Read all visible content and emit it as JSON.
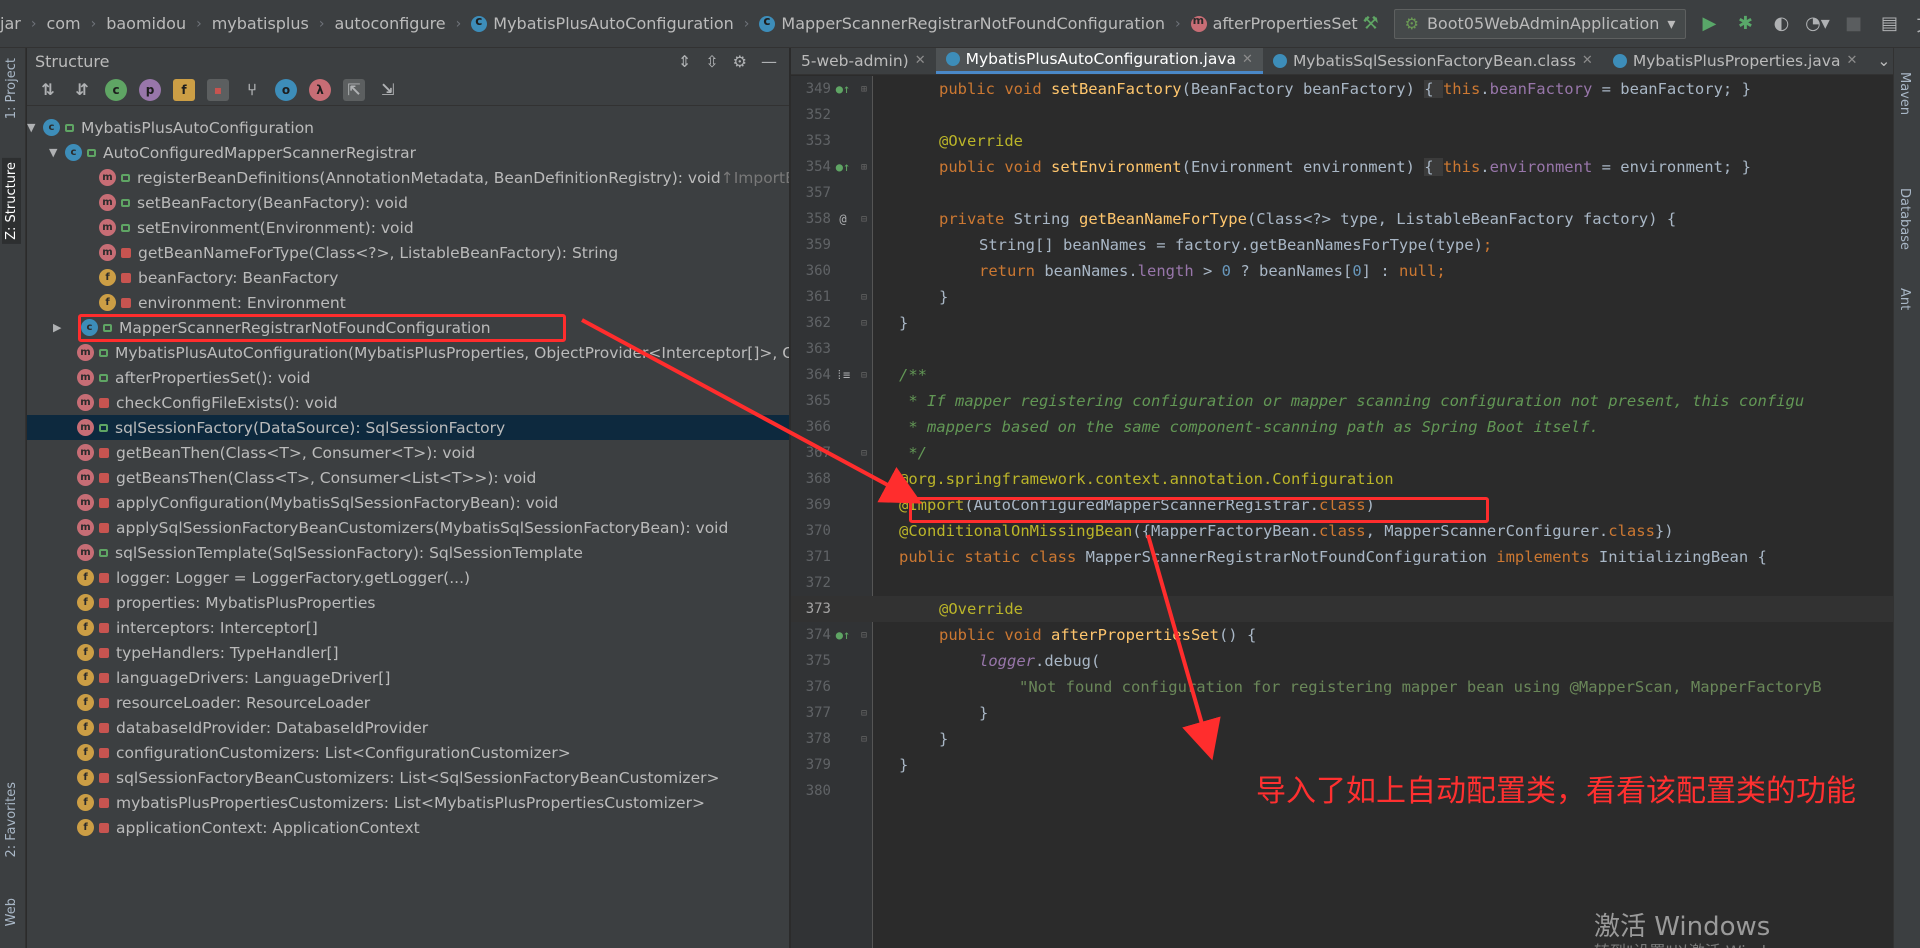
{
  "navbar": {
    "crumbs": [
      "jar",
      "com",
      "baomidou",
      "mybatisplus",
      "autoconfigure",
      "MybatisPlusAutoConfiguration",
      "MapperScannerRegistrarNotFoundConfiguration",
      "afterPropertiesSet"
    ],
    "run_config": "Boot05WebAdminApplication"
  },
  "left_strip": {
    "project_tab": "1: Project",
    "structure_tab": "Z: Structure",
    "favorites_tab": "2: Favorites",
    "web_tab": "Web"
  },
  "structure": {
    "title": "Structure",
    "items": [
      {
        "text": "MybatisPlusAutoConfiguration",
        "hint": ""
      },
      {
        "text": "AutoConfiguredMapperScannerRegistrar",
        "hint": ""
      },
      {
        "text": "registerBeanDefinitions(AnnotationMetadata, BeanDefinitionRegistry): void",
        "hint": " ↑ImportBeanD"
      },
      {
        "text": "setBeanFactory(BeanFactory): void",
        "hint": ""
      },
      {
        "text": "setEnvironment(Environment): void",
        "hint": ""
      },
      {
        "text": "getBeanNameForType(Class<?>, ListableBeanFactory): String",
        "hint": ""
      },
      {
        "text": "beanFactory: BeanFactory",
        "hint": ""
      },
      {
        "text": "environment: Environment",
        "hint": ""
      },
      {
        "text": "MapperScannerRegistrarNotFoundConfiguration",
        "hint": ""
      },
      {
        "text": "MybatisPlusAutoConfiguration(MybatisPlusProperties, ObjectProvider<Interceptor[]>, Obje",
        "hint": ""
      },
      {
        "text": "afterPropertiesSet(): void",
        "hint": ""
      },
      {
        "text": "checkConfigFileExists(): void",
        "hint": ""
      },
      {
        "text": "sqlSessionFactory(DataSource): SqlSessionFactory",
        "hint": ""
      },
      {
        "text": "getBeanThen(Class<T>, Consumer<T>): void",
        "hint": ""
      },
      {
        "text": "getBeansThen(Class<T>, Consumer<List<T>>): void",
        "hint": ""
      },
      {
        "text": "applyConfiguration(MybatisSqlSessionFactoryBean): void",
        "hint": ""
      },
      {
        "text": "applySqlSessionFactoryBeanCustomizers(MybatisSqlSessionFactoryBean): void",
        "hint": ""
      },
      {
        "text": "sqlSessionTemplate(SqlSessionFactory): SqlSessionTemplate",
        "hint": ""
      },
      {
        "text": "logger: Logger = LoggerFactory.getLogger(...)",
        "hint": ""
      },
      {
        "text": "properties: MybatisPlusProperties",
        "hint": ""
      },
      {
        "text": "interceptors: Interceptor[]",
        "hint": ""
      },
      {
        "text": "typeHandlers: TypeHandler[]",
        "hint": ""
      },
      {
        "text": "languageDrivers: LanguageDriver[]",
        "hint": ""
      },
      {
        "text": "resourceLoader: ResourceLoader",
        "hint": ""
      },
      {
        "text": "databaseIdProvider: DatabaseIdProvider",
        "hint": ""
      },
      {
        "text": "configurationCustomizers: List<ConfigurationCustomizer>",
        "hint": ""
      },
      {
        "text": "sqlSessionFactoryBeanCustomizers: List<SqlSessionFactoryBeanCustomizer>",
        "hint": ""
      },
      {
        "text": "mybatisPlusPropertiesCustomizers: List<MybatisPlusPropertiesCustomizer>",
        "hint": ""
      },
      {
        "text": "applicationContext: ApplicationContext",
        "hint": ""
      }
    ]
  },
  "tabs": [
    {
      "label": "5-web-admin)",
      "active": false
    },
    {
      "label": "MybatisPlusAutoConfiguration.java",
      "active": true
    },
    {
      "label": "MybatisSqlSessionFactoryBean.class",
      "active": false
    },
    {
      "label": "MybatisPlusProperties.java",
      "active": false
    }
  ],
  "code": {
    "line_numbers": [
      "349",
      "352",
      "353",
      "354",
      "357",
      "358",
      "359",
      "360",
      "361",
      "362",
      "363",
      "364",
      "365",
      "366",
      "367",
      "368",
      "369",
      "370",
      "371",
      "372",
      "373",
      "374",
      "375",
      "376",
      "377",
      "378",
      "379",
      "380"
    ],
    "l349a": "public void ",
    "l349b": "setBeanFactory",
    "l349c": "(BeanFactory beanFactory) ",
    "l349d": "{ ",
    "l349e": "this",
    "l349f": ".",
    "l349g": "beanFactory",
    "l349h": " = beanFactory; }",
    "l353": "@Override",
    "l354a": "public void ",
    "l354b": "setEnvironment",
    "l354c": "(Environment environment) ",
    "l354d": "{ ",
    "l354e": "this",
    "l354f": ".",
    "l354g": "environment",
    "l354h": " = environment; }",
    "l358a": "private ",
    "l358b": "String ",
    "l358c": "getBeanNameForType",
    "l358d": "(Class<?> type, ListableBeanFactory factory) {",
    "l359a": "String[] beanNames = factory.getBeanNamesForType(type)",
    "l359b": ";",
    "l360a": "return ",
    "l360b": "beanNames.",
    "l360c": "length",
    "l360d": " > ",
    "l360e": "0",
    "l360f": " ? beanNames[",
    "l360g": "0",
    "l360h": "] : ",
    "l360i": "null",
    "l360j": ";",
    "l361": "}",
    "l362": "}",
    "l364": "/**",
    "l365": " * If mapper registering configuration or mapper scanning configuration not present, this configu",
    "l366": " * mappers based on the same component-scanning path as Spring Boot itself.",
    "l367": " */",
    "l368a": "@org.springframework.context.annotation.",
    "l368b": "Configuration",
    "l369a": "@Import",
    "l369b": "(AutoConfiguredMapperScannerRegistrar.",
    "l369c": "class",
    "l369d": ")",
    "l370a": "@ConditionalOnMissingBean",
    "l370b": "({MapperFactoryBean.",
    "l370c": "class",
    "l370d": ", MapperScannerConfigurer.",
    "l370e": "class",
    "l370f": "})",
    "l371a": "public static class ",
    "l371b": "MapperScannerRegistrarNotFoundConfiguration ",
    "l371c": "implements ",
    "l371d": "InitializingBean {",
    "l373": "@Override",
    "l374a": "public void ",
    "l374b": "afterPropertiesSet",
    "l374c": "() {",
    "l375a": "logger",
    "l375b": ".debug(",
    "l376": "\"Not found configuration for registering mapper bean using @MapperScan, MapperFactoryB",
    "l377": "}",
    "l378": "}",
    "l379": "}"
  },
  "right_strip": {
    "maven_tab": "Maven",
    "database_tab": "Database",
    "ant_tab": "Ant"
  },
  "annotation_text": "导入了如上自动配置类，看看该配置类的功能",
  "watermark": "激活 Windows",
  "watermark_sub": "转到\"设置\"以激活 Windows。"
}
